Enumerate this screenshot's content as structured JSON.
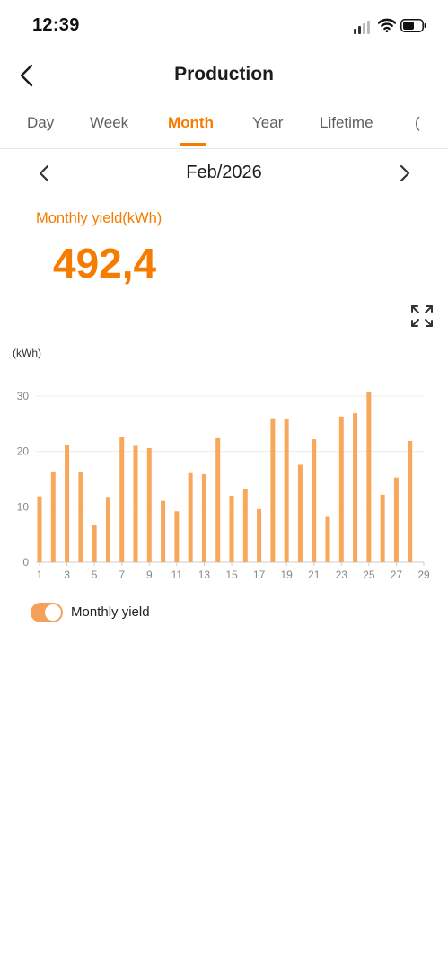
{
  "status_bar": {
    "time": "12:39"
  },
  "header": {
    "title": "Production"
  },
  "tabs": [
    {
      "label": "Day",
      "active": false
    },
    {
      "label": "Week",
      "active": false
    },
    {
      "label": "Month",
      "active": true
    },
    {
      "label": "Year",
      "active": false
    },
    {
      "label": "Lifetime",
      "active": false
    }
  ],
  "date_selector": {
    "label": "Feb/2026"
  },
  "summary": {
    "label": "Monthly yield(kWh)",
    "value": "492,4"
  },
  "colors": {
    "accent": "#f57c00",
    "bar": "#f7a85a",
    "toggle": "#f5a058"
  },
  "icons": [
    "back-arrow-icon",
    "chevron-left-icon",
    "chevron-right-icon",
    "fullscreen-expand-icon",
    "signal-icon",
    "wifi-icon",
    "battery-icon"
  ],
  "chart_data": {
    "type": "bar",
    "ylabel": "(kWh)",
    "ylim": [
      0,
      30
    ],
    "yticks": [
      0,
      10,
      20,
      30
    ],
    "xticks": [
      1,
      3,
      5,
      7,
      9,
      11,
      13,
      15,
      17,
      19,
      21,
      23,
      25,
      27,
      29
    ],
    "grid": true,
    "x": [
      1,
      2,
      3,
      4,
      5,
      6,
      7,
      8,
      9,
      10,
      11,
      12,
      13,
      14,
      15,
      16,
      17,
      18,
      19,
      20,
      21,
      22,
      23,
      24,
      25,
      26,
      27,
      28
    ],
    "series": [
      {
        "name": "Monthly yield",
        "values": [
          11.9,
          16.4,
          21.1,
          16.3,
          6.8,
          11.8,
          22.6,
          21.0,
          20.6,
          11.1,
          9.2,
          16.1,
          15.9,
          22.4,
          12.0,
          13.3,
          9.6,
          26.0,
          25.9,
          17.6,
          22.2,
          8.2,
          26.3,
          26.9,
          30.8,
          12.2,
          15.3,
          21.9
        ]
      }
    ]
  },
  "legend": {
    "label": "Monthly yield"
  }
}
